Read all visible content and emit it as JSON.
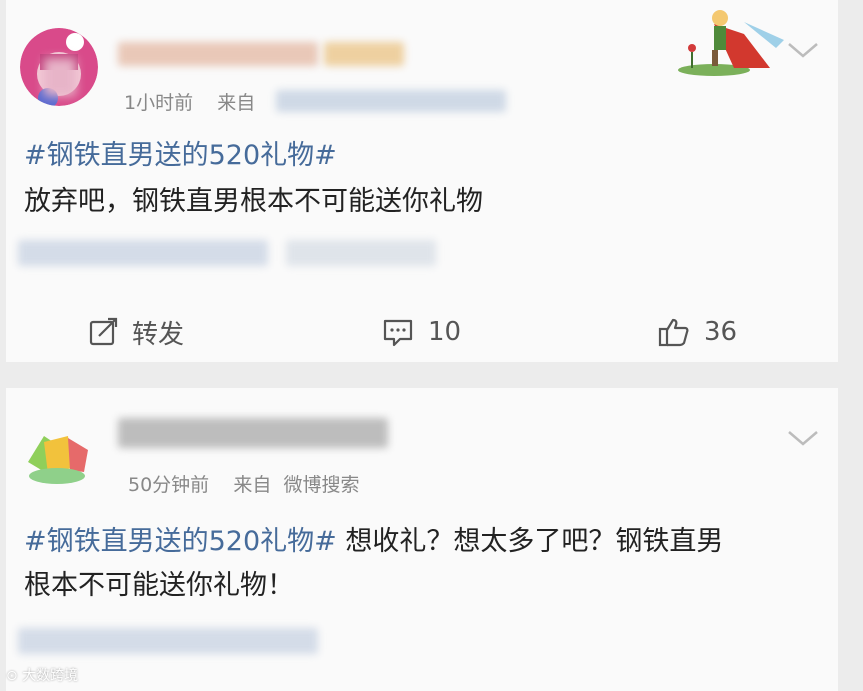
{
  "posts": [
    {
      "time": "1小时前",
      "source_prefix": "来自",
      "source": "",
      "hashtag": "#钢铁直男送的520礼物#",
      "text": "放弃吧，钢铁直男根本不可能送你礼物",
      "actions": {
        "repost_label": "转发",
        "comments": "10",
        "likes": "36"
      }
    },
    {
      "time": "50分钟前",
      "source_prefix": "来自",
      "source": "微博搜索",
      "hashtag": "#钢铁直男送的520礼物#",
      "text_line1": " 想收礼？想太多了吧？钢铁直男",
      "text_line2": "根本不可能送你礼物！"
    }
  ],
  "watermark": "大数跨境",
  "icons": {
    "menu": "chevron-down-icon",
    "repost": "repost-icon",
    "comment": "comment-icon",
    "like": "thumbs-up-icon"
  },
  "colors": {
    "hashtag": "#466b9a",
    "meta": "#888888",
    "background": "#ececec",
    "card": "#fafafa"
  }
}
